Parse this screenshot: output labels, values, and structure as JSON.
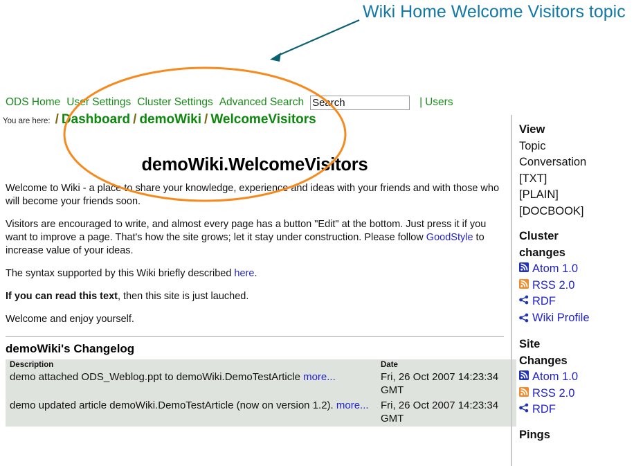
{
  "annotation": {
    "text": "Wiki Home Welcome Visitors topic",
    "color": "#1378A8",
    "arrow_color": "#0A6271",
    "ellipse_color": "#F58A1F"
  },
  "topnav": {
    "links": [
      {
        "label": "ODS Home"
      },
      {
        "label": "User Settings"
      },
      {
        "label": "Cluster Settings"
      },
      {
        "label": "Advanced Search"
      }
    ],
    "search": {
      "value": "Search",
      "placeholder": "Search"
    },
    "separator": "|",
    "users_label": "Users",
    "link_color": "#1a8a1a"
  },
  "breadcrumb": {
    "prefix": "You are here:",
    "separator": "/",
    "crumbs": [
      {
        "label": "Dashboard"
      },
      {
        "label": "demoWiki"
      },
      {
        "label": "WelcomeVisitors"
      }
    ]
  },
  "main": {
    "title": "demoWiki.WelcomeVisitors",
    "paragraphs": [
      {
        "id": "p1",
        "parts": [
          {
            "type": "text",
            "text": "Welcome to Wiki - a place to share your knowledge, experience and ideas with your friends and with those who will become your friends soon."
          }
        ]
      },
      {
        "id": "p2",
        "parts": [
          {
            "type": "text",
            "text": "Visitors are encouraged to write, and almost every page has a button \"Edit\" at the bottom. Just press it if you want to improve a page. That's how the site grows; let it stay under construction. Please follow "
          },
          {
            "type": "link",
            "text": "GoodStyle"
          },
          {
            "type": "text",
            "text": " to increase value of your ideas."
          }
        ]
      },
      {
        "id": "p3",
        "parts": [
          {
            "type": "text",
            "text": "The syntax supported by this Wiki briefly described "
          },
          {
            "type": "link",
            "text": "here"
          },
          {
            "type": "text",
            "text": "."
          }
        ]
      },
      {
        "id": "p4",
        "parts": [
          {
            "type": "bold",
            "text": "If you can read this text"
          },
          {
            "type": "text",
            "text": ", then this site is just lauched."
          }
        ]
      },
      {
        "id": "p5",
        "parts": [
          {
            "type": "text",
            "text": "Welcome and enjoy yourself."
          }
        ]
      }
    ]
  },
  "changelog": {
    "title": "demoWiki's Changelog",
    "headers": {
      "description": "Description",
      "date": "Date"
    },
    "rows": [
      {
        "description_text": "demo attached ODS_Weblog.ppt to demoWiki.DemoTestArticle ",
        "more_label": "more...",
        "date": "Fri, 26 Oct 2007 14:23:34 GMT"
      },
      {
        "description_text": "demo updated article demoWiki.DemoTestArticle (now on version 1.2). ",
        "more_label": "more...",
        "date": "Fri, 26 Oct 2007 14:23:34 GMT"
      }
    ]
  },
  "sidebar": {
    "view": {
      "heading": "View",
      "items": [
        {
          "label": "Topic"
        },
        {
          "label": "Conversation"
        },
        {
          "label": "[TXT]"
        },
        {
          "label": "[PLAIN]"
        },
        {
          "label": "[DOCBOOK]"
        }
      ]
    },
    "cluster_changes": {
      "heading_line1": "Cluster",
      "heading_line2": "changes",
      "feeds": [
        {
          "label": "Atom 1.0",
          "icon": "atom-feed-icon",
          "icon_color": "#2233BB"
        },
        {
          "label": "RSS 2.0",
          "icon": "rss-feed-icon",
          "icon_color": "#F28B2B"
        },
        {
          "label": "RDF",
          "icon": "rdf-share-icon",
          "icon_color": "#2233BB"
        },
        {
          "label": "Wiki Profile",
          "icon": "rdf-share-icon",
          "icon_color": "#2233BB"
        }
      ]
    },
    "site_changes": {
      "heading_line1": "Site",
      "heading_line2": "Changes",
      "feeds": [
        {
          "label": "Atom 1.0",
          "icon": "atom-feed-icon",
          "icon_color": "#2233BB"
        },
        {
          "label": "RSS 2.0",
          "icon": "rss-feed-icon",
          "icon_color": "#F28B2B"
        },
        {
          "label": "RDF",
          "icon": "rdf-share-icon",
          "icon_color": "#2233BB"
        }
      ]
    },
    "pings": {
      "heading": "Pings"
    }
  }
}
